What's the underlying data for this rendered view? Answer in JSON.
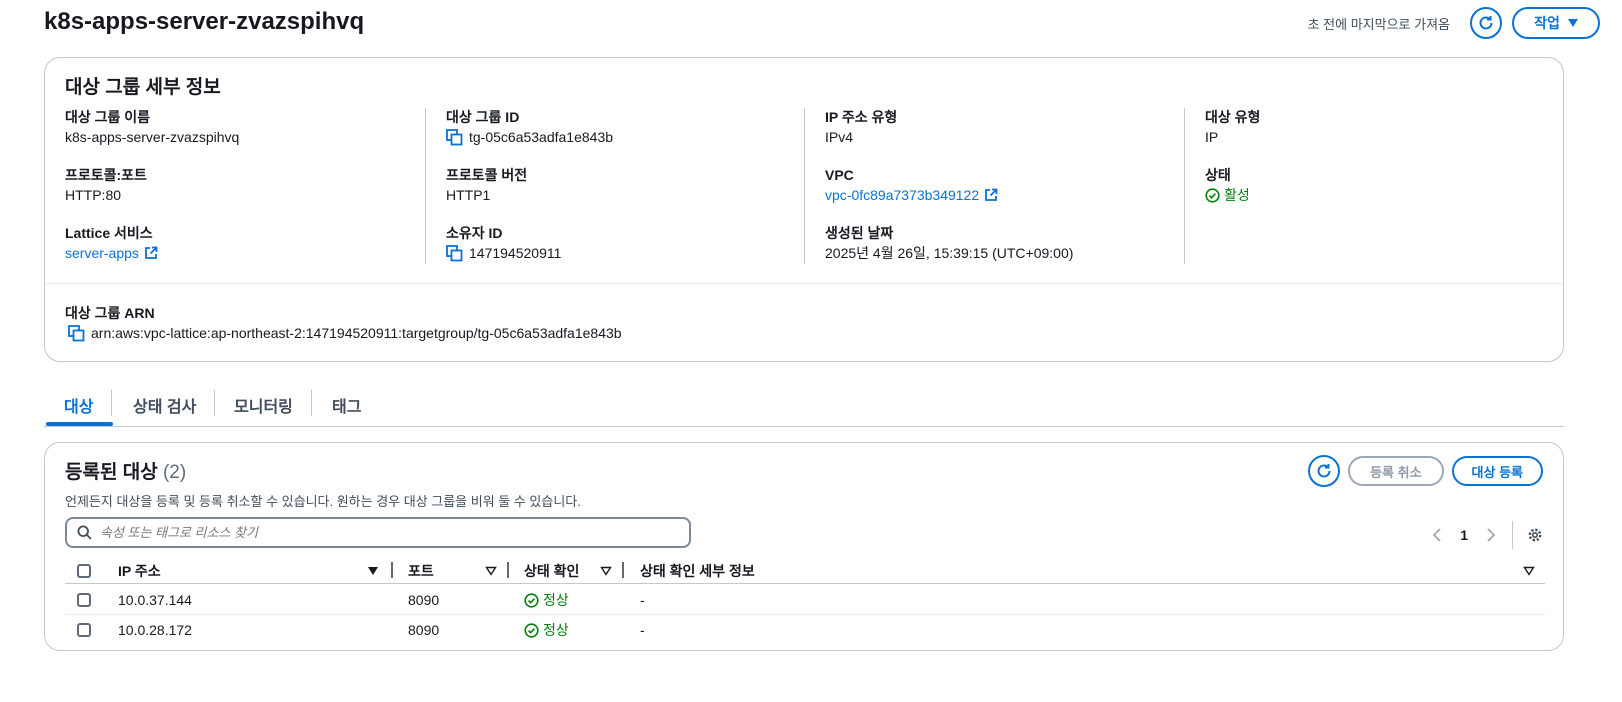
{
  "header": {
    "title": "k8s-apps-server-zvazspihvq",
    "last_fetched": "초 전에 마지막으로 가져옴",
    "actions_label": "작업"
  },
  "details": {
    "title": "대상 그룹 세부 정보",
    "fields": {
      "tg_name_label": "대상 그룹 이름",
      "tg_name": "k8s-apps-server-zvazspihvq",
      "protocol_port_label": "프로토콜:포트",
      "protocol_port": "HTTP:80",
      "lattice_label": "Lattice 서비스",
      "lattice_value": "server-apps",
      "tg_id_label": "대상 그룹 ID",
      "tg_id": "tg-05c6a53adfa1e843b",
      "protocol_version_label": "프로토콜 버전",
      "protocol_version": "HTTP1",
      "owner_label": "소유자 ID",
      "owner": "147194520911",
      "ip_type_label": "IP 주소 유형",
      "ip_type": "IPv4",
      "vpc_label": "VPC",
      "vpc": "vpc-0fc89a7373b349122",
      "created_label": "생성된 날짜",
      "created": "2025년 4월 26일, 15:39:15 (UTC+09:00)",
      "target_type_label": "대상 유형",
      "target_type": "IP",
      "status_label": "상태",
      "status": "활성"
    },
    "arn_label": "대상 그룹 ARN",
    "arn": "arn:aws:vpc-lattice:ap-northeast-2:147194520911:targetgroup/tg-05c6a53adfa1e843b"
  },
  "tabs": [
    "대상",
    "상태 검사",
    "모니터링",
    "태그"
  ],
  "targets": {
    "title": "등록된 대상",
    "count": "(2)",
    "description": "언제든지 대상을 등록 및 등록 취소할 수 있습니다. 원하는 경우 대상 그룹을 비워 둘 수 있습니다.",
    "deregister_label": "등록 취소",
    "register_label": "대상 등록",
    "search_placeholder": "속성 또는 태그로 리소스 찾기",
    "page": "1",
    "columns": [
      "IP 주소",
      "포트",
      "상태 확인",
      "상태 확인 세부 정보"
    ],
    "rows": [
      {
        "ip": "10.0.37.144",
        "port": "8090",
        "health": "정상",
        "details": "-"
      },
      {
        "ip": "10.0.28.172",
        "port": "8090",
        "health": "정상",
        "details": "-"
      }
    ]
  },
  "colors": {
    "accent": "#0972d3",
    "success": "#037f0c",
    "border": "#c6c6cd"
  },
  "icons": [
    "refresh-icon",
    "caret-down-icon",
    "copy-icon",
    "external-link-icon",
    "status-check-icon",
    "search-icon",
    "chevron-left-icon",
    "chevron-right-icon",
    "settings-icon",
    "sort-icon"
  ]
}
